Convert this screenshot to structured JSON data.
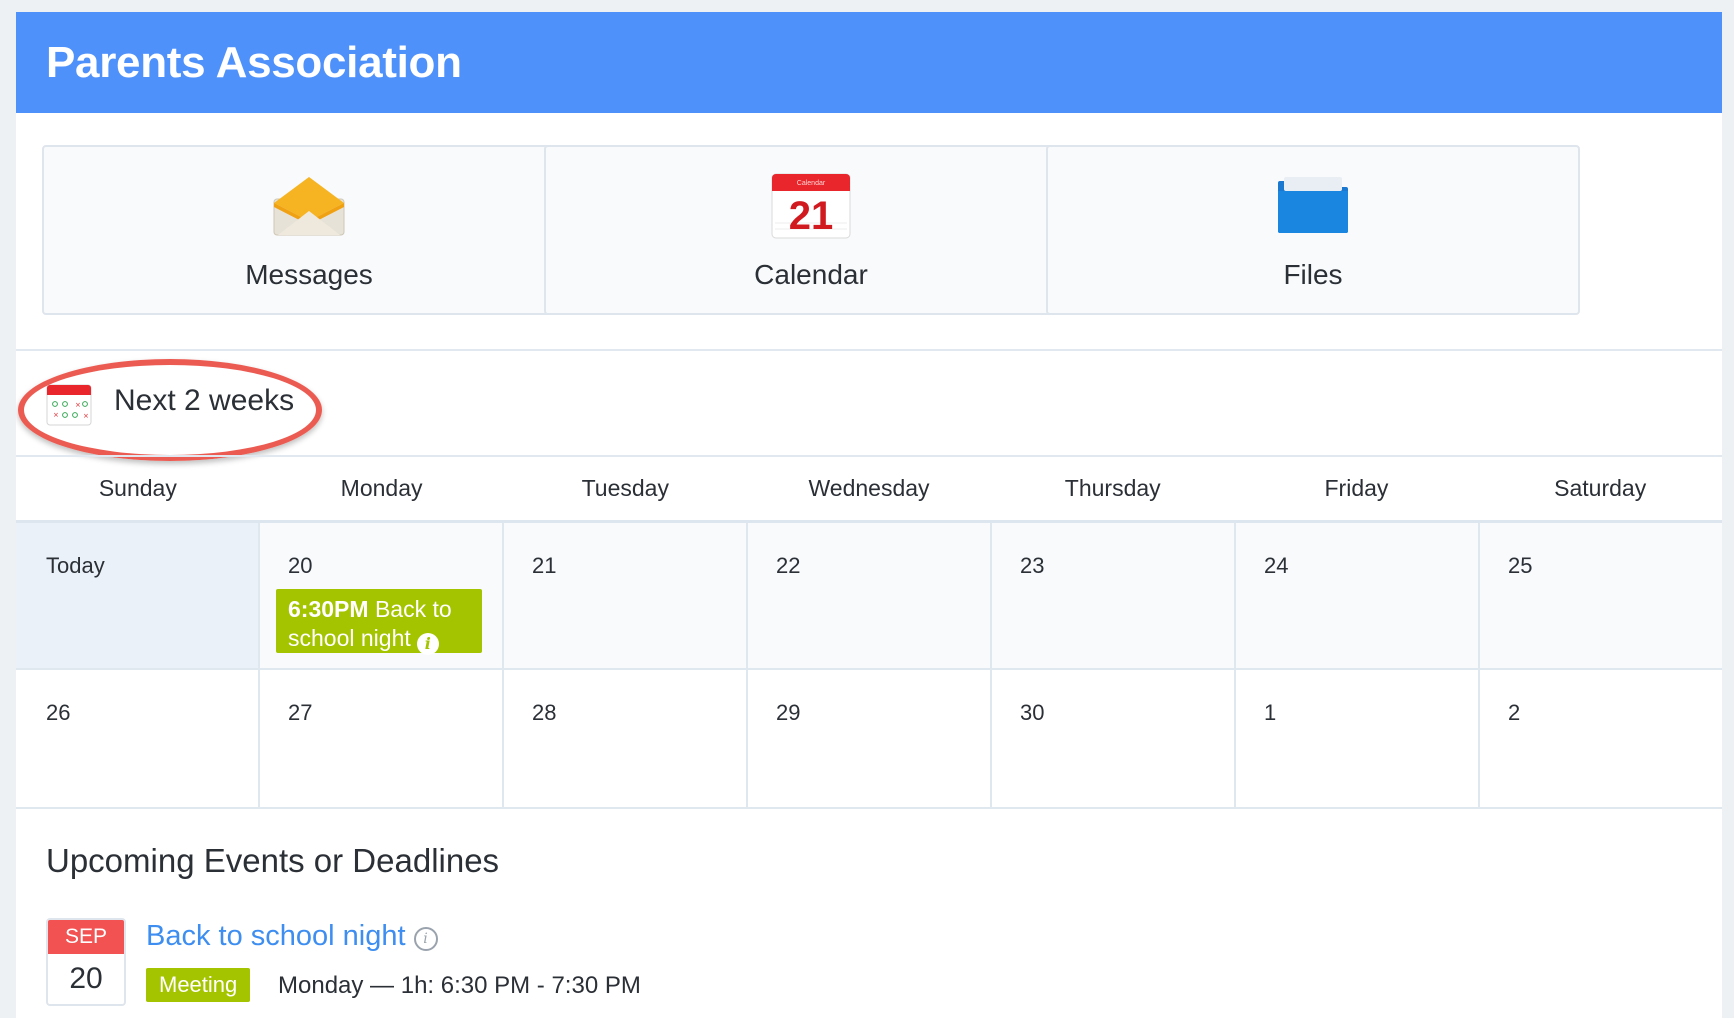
{
  "header": {
    "title": "Parents Association"
  },
  "tiles": [
    {
      "label": "Messages",
      "icon": "envelope-icon"
    },
    {
      "label": "Calendar",
      "icon": "calendar-icon",
      "icon_text": "21",
      "icon_caption": "Calendar"
    },
    {
      "label": "Files",
      "icon": "folder-icon"
    }
  ],
  "next_weeks": {
    "label": "Next 2 weeks",
    "icon": "calendar-grid-icon",
    "highlight_color": "#ec5b52"
  },
  "weekdays": [
    "Sunday",
    "Monday",
    "Tuesday",
    "Wednesday",
    "Thursday",
    "Friday",
    "Saturday"
  ],
  "weeks": [
    [
      "Today",
      "20",
      "21",
      "22",
      "23",
      "24",
      "25"
    ],
    [
      "26",
      "27",
      "28",
      "29",
      "30",
      "1",
      "2"
    ]
  ],
  "calendar_event": {
    "time": "6:30PM",
    "title": "Back to school night",
    "info_icon": "info-icon",
    "color": "#a4c400"
  },
  "upcoming": {
    "heading": "Upcoming Events or Deadlines",
    "items": [
      {
        "month": "SEP",
        "day": "20",
        "title": "Back to school night",
        "badge": "Meeting",
        "when": "Monday — 1h: 6:30 PM - 7:30 PM"
      }
    ]
  },
  "colors": {
    "header": "#4f91fb",
    "accent_green": "#a4c400",
    "link_blue": "#3d8ef0",
    "date_red": "#f25252"
  }
}
